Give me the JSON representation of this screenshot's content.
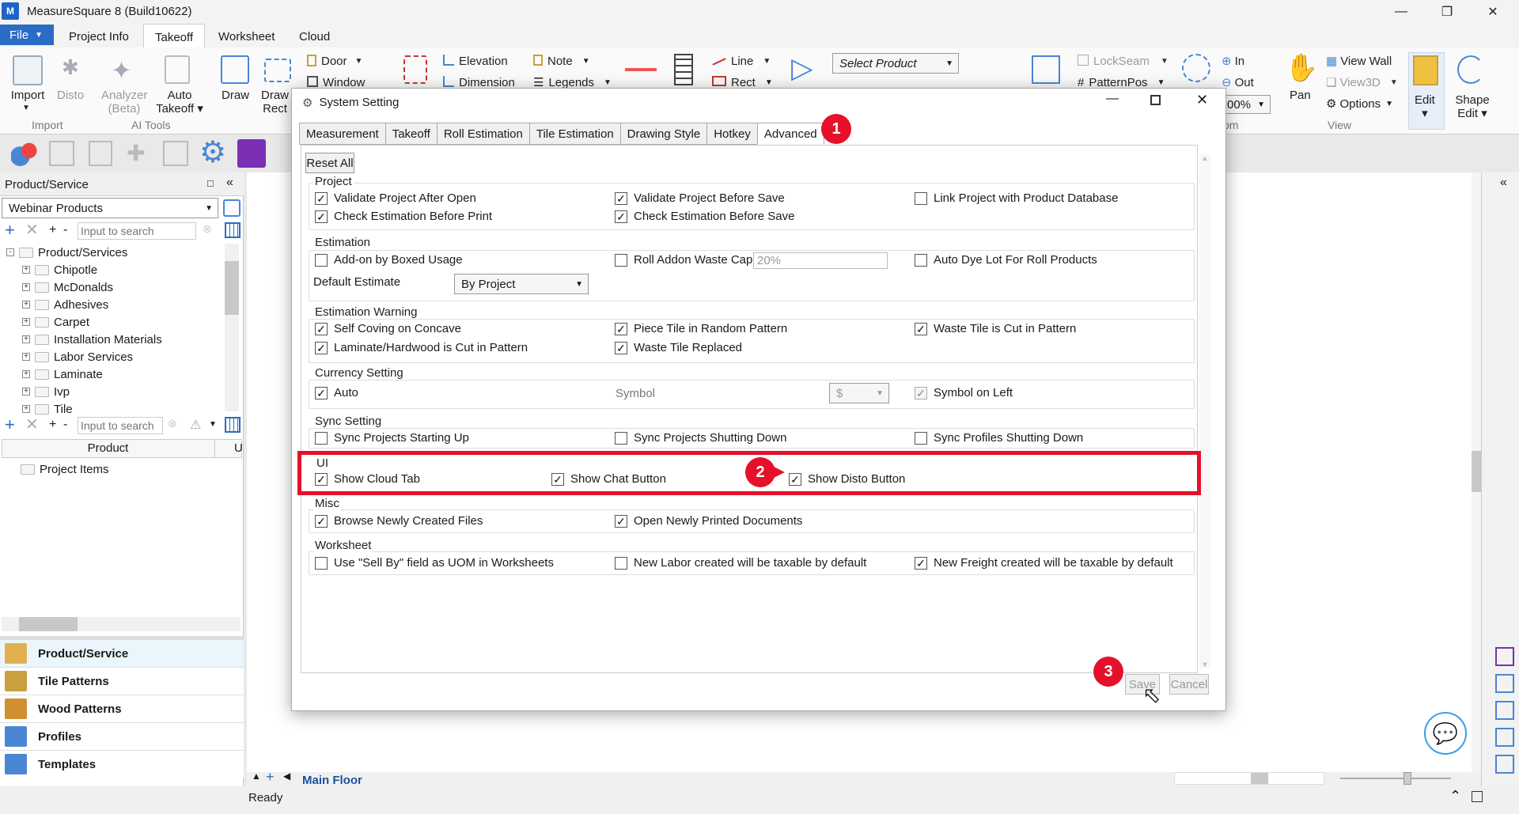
{
  "app": {
    "title": "MeasureSquare 8 (Build10622)",
    "icon_text": "M"
  },
  "menu": {
    "file": "File",
    "items": [
      "Project Info",
      "Takeoff",
      "Worksheet",
      "Cloud"
    ]
  },
  "ribbon": {
    "import": {
      "import": "Import",
      "disto": "Disto",
      "group": "Import"
    },
    "ai": {
      "analyzer": "Analyzer",
      "beta": "(Beta)",
      "auto": "Auto",
      "takeoff": "Takeoff",
      "group": "AI Tools"
    },
    "draw": "Draw",
    "draw_rect": "Draw",
    "draw_rect2": "Rect",
    "door": "Door",
    "window": "Window",
    "elevation": "Elevation",
    "dimension": "Dimension",
    "note": "Note",
    "legends": "Legends",
    "line": "Line",
    "rect": "Rect",
    "select_product": "Select Product",
    "lockseam": "LockSeam",
    "patternpos": "PatternPos",
    "zoom_in": "In",
    "zoom_out": "Out",
    "zoom_value": "00%",
    "pan": "Pan",
    "view_wall": "View Wall",
    "view3d": "View3D",
    "options": "Options",
    "view_group": "View",
    "edit": "Edit",
    "shape_edit": "Shape",
    "shape_edit2": "Edit",
    "om_label": "om"
  },
  "panel": {
    "title": "Product/Service",
    "dropdown": "Webinar Products",
    "search_placeholder": "Input to search",
    "tree_root": "Product/Services",
    "tree_items": [
      "Chipotle",
      "McDonalds",
      "Adhesives",
      "Carpet",
      "Installation Materials",
      "Labor Services",
      "Laminate",
      "Ivp",
      "Tile"
    ],
    "search2_placeholder": "Input to search",
    "col_product": "Product",
    "col_u": "U",
    "project_items": "Project Items",
    "nav": [
      "Product/Service",
      "Tile Patterns",
      "Wood Patterns",
      "Profiles",
      "Templates"
    ]
  },
  "canvas": {
    "floor_tab": "Main Floor"
  },
  "status": {
    "text": "Ready"
  },
  "dialog": {
    "title": "System Setting",
    "tabs": [
      "Measurement",
      "Takeoff",
      "Roll Estimation",
      "Tile Estimation",
      "Drawing Style",
      "Hotkey",
      "Advanced"
    ],
    "reset_all": "Reset All",
    "project": {
      "title": "Project",
      "validate_after_open": "Validate Project After Open",
      "validate_before_save": "Validate Project Before Save",
      "link_db": "Link Project with Product Database",
      "check_before_print": "Check Estimation Before Print",
      "check_before_save": "Check Estimation Before Save"
    },
    "estimation": {
      "title": "Estimation",
      "addon_boxed": "Add-on by Boxed Usage",
      "roll_addon_cap": "Roll Addon Waste Cap",
      "roll_addon_value": "20%",
      "auto_dye": "Auto Dye Lot For Roll Products",
      "default_estimate": "Default Estimate",
      "default_value": "By Project"
    },
    "warning": {
      "title": "Estimation Warning",
      "self_coving": "Self Coving on Concave",
      "piece_tile": "Piece Tile in Random Pattern",
      "waste_cut": "Waste Tile is Cut in Pattern",
      "laminate_cut": "Laminate/Hardwood is Cut in Pattern",
      "waste_replaced": "Waste Tile Replaced"
    },
    "currency": {
      "title": "Currency Setting",
      "auto": "Auto",
      "symbol": "Symbol",
      "symbol_value": "$",
      "symbol_left": "Symbol on Left"
    },
    "sync": {
      "title": "Sync Setting",
      "starting": "Sync Projects Starting Up",
      "shutting": "Sync Projects Shutting Down",
      "profiles": "Sync Profiles Shutting Down"
    },
    "ui": {
      "title": "UI",
      "cloud_tab": "Show Cloud Tab",
      "chat": "Show Chat Button",
      "disto": "Show Disto Button"
    },
    "misc": {
      "title": "Misc",
      "browse": "Browse Newly Created Files",
      "open_printed": "Open Newly Printed Documents"
    },
    "worksheet": {
      "title": "Worksheet",
      "sell_by": "Use \"Sell By\" field as UOM in Worksheets",
      "labor_tax": "New Labor created will be taxable by default",
      "freight_tax": "New Freight created will be taxable by default"
    },
    "save": "Save",
    "cancel": "Cancel"
  },
  "annotations": {
    "b1": "1",
    "b2": "2",
    "b3": "3"
  },
  "colors": {
    "accent": "#2b6cc4",
    "highlight": "#e5112a"
  }
}
